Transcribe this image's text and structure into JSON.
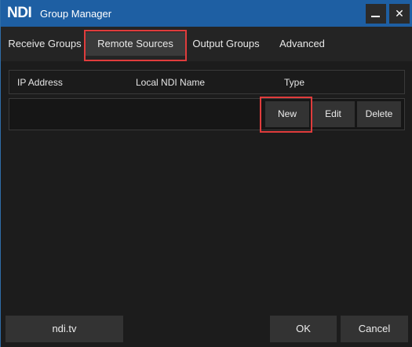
{
  "window": {
    "logo": "NDI",
    "title": "Group Manager",
    "minimize_label": "",
    "close_label": "✕"
  },
  "tabs": [
    {
      "label": "Receive Groups",
      "active": false
    },
    {
      "label": "Remote Sources",
      "active": true
    },
    {
      "label": "Output Groups",
      "active": false
    },
    {
      "label": "Advanced",
      "active": false
    }
  ],
  "table": {
    "columns": [
      "IP Address",
      "Local NDI Name",
      "Type"
    ],
    "rows": []
  },
  "row_actions": {
    "new_label": "New",
    "edit_label": "Edit",
    "delete_label": "Delete"
  },
  "footer": {
    "link_label": "ndi.tv",
    "ok_label": "OK",
    "cancel_label": "Cancel"
  },
  "colors": {
    "titlebar": "#1e5fa3",
    "highlight": "#e03c3c",
    "button": "#333333",
    "background": "#1c1c1c"
  }
}
